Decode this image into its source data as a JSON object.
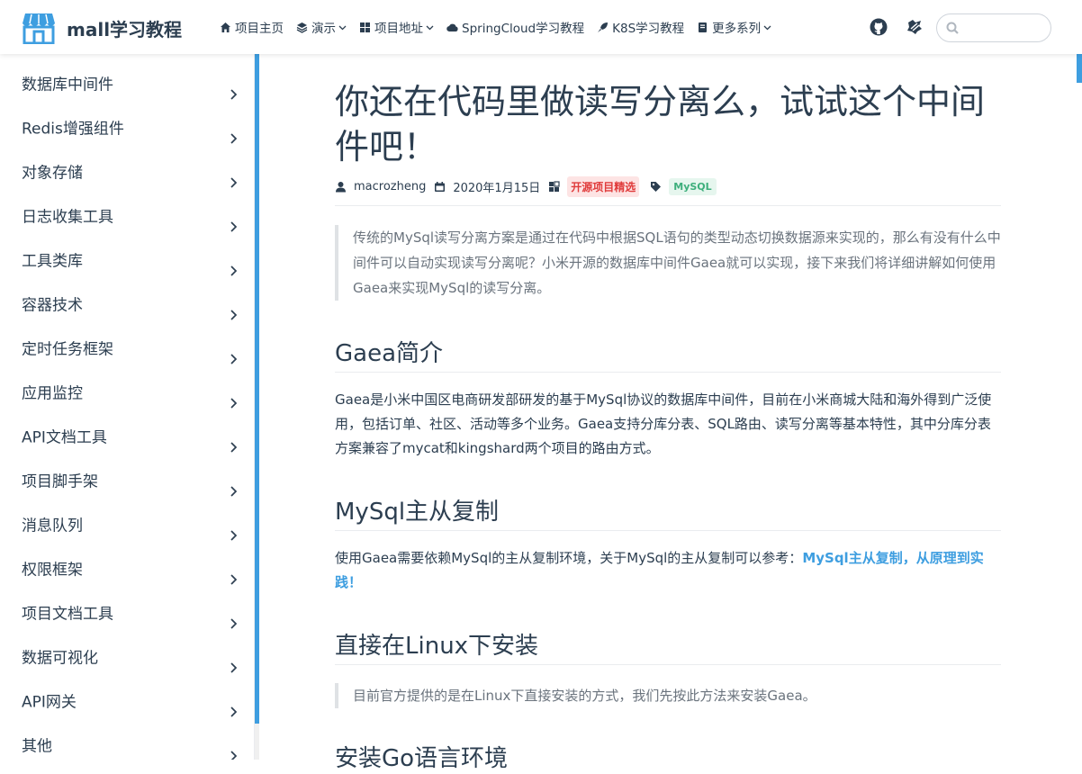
{
  "navbar": {
    "site_name": "mall学习教程",
    "links": [
      {
        "label": "项目主页",
        "icon": "home-icon",
        "dropdown": false
      },
      {
        "label": "演示",
        "icon": "layers-icon",
        "dropdown": true
      },
      {
        "label": "项目地址",
        "icon": "grid-icon",
        "dropdown": true
      },
      {
        "label": "SpringCloud学习教程",
        "icon": "cloud-icon",
        "dropdown": false
      },
      {
        "label": "K8S学习教程",
        "icon": "rocket-icon",
        "dropdown": false
      },
      {
        "label": "更多系列",
        "icon": "book-icon",
        "dropdown": true
      }
    ],
    "right_icons": [
      "github-icon",
      "gitee-icon"
    ],
    "search": {
      "placeholder": "",
      "value": ""
    }
  },
  "sidebar": {
    "items": [
      {
        "label": "数据库中间件"
      },
      {
        "label": "Redis增强组件"
      },
      {
        "label": "对象存储"
      },
      {
        "label": "日志收集工具"
      },
      {
        "label": "工具类库"
      },
      {
        "label": "容器技术"
      },
      {
        "label": "定时任务框架"
      },
      {
        "label": "应用监控"
      },
      {
        "label": "API文档工具"
      },
      {
        "label": "项目脚手架"
      },
      {
        "label": "消息队列"
      },
      {
        "label": "权限框架"
      },
      {
        "label": "项目文档工具"
      },
      {
        "label": "数据可视化"
      },
      {
        "label": "API网关"
      },
      {
        "label": "其他"
      }
    ]
  },
  "article": {
    "title": "你还在代码里做读写分离么，试试这个中间件吧！",
    "meta": {
      "author": "macrozheng",
      "date": "2020年1月15日",
      "category": "开源项目精选",
      "tag": "MySQL"
    },
    "intro": "传统的MySql读写分离方案是通过在代码中根据SQL语句的类型动态切换数据源来实现的，那么有没有什么中间件可以自动实现读写分离呢？小米开源的数据库中间件Gaea就可以实现，接下来我们将详细讲解如何使用Gaea来实现MySql的读写分离。",
    "sections": [
      {
        "heading": "Gaea简介",
        "text": "Gaea是小米中国区电商研发部研发的基于MySql协议的数据库中间件，目前在小米商城大陆和海外得到广泛使用，包括订单、社区、活动等多个业务。Gaea支持分库分表、SQL路由、读写分离等基本特性，其中分库分表方案兼容了mycat和kingshard两个项目的路由方式。"
      },
      {
        "heading": "MySql主从复制",
        "text": "使用Gaea需要依赖MySql的主从复制环境，关于MySql的主从复制可以参考：",
        "link": "MySql主从复制，从原理到实践！"
      },
      {
        "heading": "直接在Linux下安装",
        "quote": "目前官方提供的是在Linux下直接安装的方式，我们先按此方法来安装Gaea。"
      },
      {
        "heading": "安装Go语言环境"
      }
    ]
  },
  "colors": {
    "accent": "#3e9ee0",
    "text": "#2c3e50",
    "category_tag": "#e03b3b",
    "mysql_tag": "#3eaf7c"
  }
}
